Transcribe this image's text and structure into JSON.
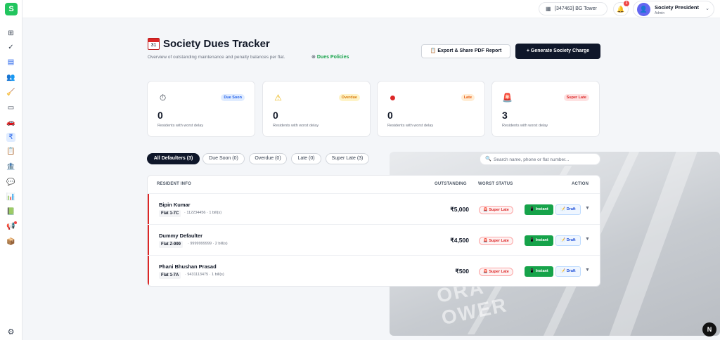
{
  "app": {
    "logo_letter": "S"
  },
  "sidebar": {
    "icons": [
      {
        "name": "dashboard-icon",
        "glyph": "⊞"
      },
      {
        "name": "check-icon",
        "glyph": "✓"
      },
      {
        "name": "id-card-icon",
        "glyph": "▤"
      },
      {
        "name": "users-icon",
        "glyph": "👥"
      },
      {
        "name": "broom-icon",
        "glyph": "🧹"
      },
      {
        "name": "monitor-icon",
        "glyph": "▭"
      },
      {
        "name": "car-icon",
        "glyph": "🚗"
      },
      {
        "name": "ledger-icon",
        "glyph": "₹"
      },
      {
        "name": "clipboard-icon",
        "glyph": "📋"
      },
      {
        "name": "bank-icon",
        "glyph": "🏦"
      },
      {
        "name": "chat-icon",
        "glyph": "💬"
      },
      {
        "name": "chart-icon",
        "glyph": "📊"
      },
      {
        "name": "report-icon",
        "glyph": "📗"
      },
      {
        "name": "megaphone-icon",
        "glyph": "📢"
      },
      {
        "name": "package-icon",
        "glyph": "📦"
      }
    ],
    "settings_glyph": "⚙"
  },
  "topbar": {
    "society": "[347463] BG Tower",
    "notifications_count": "3",
    "user_name": "Society President",
    "user_role": "Admin"
  },
  "header": {
    "title": "Society Dues Tracker",
    "calendar_day": "31",
    "subtitle": "Overview of outstanding maintenance and penalty balances per flat.",
    "policies_link": "Dues Policies",
    "export_button": "Export & Share PDF Report",
    "generate_button": "+ Generate Society Charge"
  },
  "cards": [
    {
      "icon": "⏱",
      "badge": "Due Soon",
      "value": "0",
      "desc": "Residents with worst delay",
      "badge_bg": "#e0ecff",
      "badge_fg": "#2563eb"
    },
    {
      "icon": "⚠",
      "badge": "Overdue",
      "value": "0",
      "desc": "Residents with worst delay",
      "badge_bg": "#fef3c7",
      "badge_fg": "#d97706"
    },
    {
      "icon": "●",
      "badge": "Late",
      "value": "0",
      "desc": "Residents with worst delay",
      "badge_bg": "#ffedd5",
      "badge_fg": "#ea580c"
    },
    {
      "icon": "🚨",
      "badge": "Super Late",
      "value": "3",
      "desc": "Residents with worst delay",
      "badge_bg": "#fee2e2",
      "badge_fg": "#dc2626"
    }
  ],
  "tabs": [
    "All Defaulters (3)",
    "Due Soon (0)",
    "Overdue (0)",
    "Late (0)",
    "Super Late (3)"
  ],
  "search": {
    "placeholder": "Search name, phone or flat number..."
  },
  "table": {
    "headers": {
      "resident": "RESIDENT INFO",
      "outstanding": "OUTSTANDING",
      "status": "WORST STATUS",
      "action": "ACTION"
    },
    "rows": [
      {
        "name": "Bipin Kumar",
        "flat": "Flat 1-7C",
        "meta": "· 112234456 · 1 bill(s)",
        "amount": "₹5,000",
        "status": "Super Late",
        "instant": "Instant",
        "draft": "Draft"
      },
      {
        "name": "Dummy Defaulter",
        "flat": "Flat Z-999",
        "meta": "· 9999999999 · 2 bill(s)",
        "amount": "₹4,500",
        "status": "Super Late",
        "instant": "Instant",
        "draft": "Draft"
      },
      {
        "name": "Phani Bhushan Prasad",
        "flat": "Flat 1-7A",
        "meta": "· 9431113475 · 1 bill(s)",
        "amount": "₹500",
        "status": "Super Late",
        "instant": "Instant",
        "draft": "Draft"
      }
    ]
  },
  "overlay": {
    "n_badge": "N",
    "photo_text": "ORA\nOWER"
  }
}
